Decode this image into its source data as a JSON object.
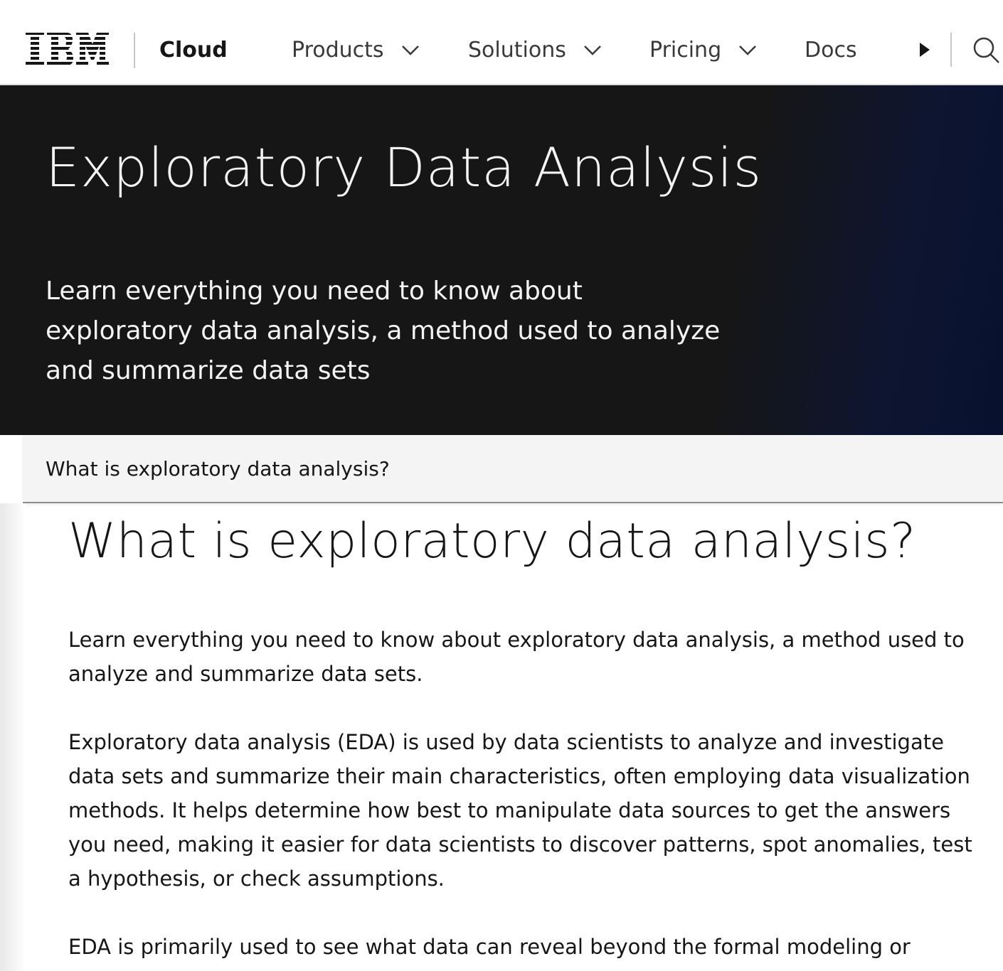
{
  "masthead": {
    "logo_text": "IBM",
    "brand": "Cloud",
    "nav": [
      {
        "label": "Products"
      },
      {
        "label": "Solutions"
      },
      {
        "label": "Pricing"
      },
      {
        "label": "Docs"
      }
    ],
    "icons": {
      "more": "caret-right-icon",
      "search": "search-icon",
      "dropdown": "chevron-down-icon"
    }
  },
  "hero": {
    "title": "Exploratory Data Analysis",
    "subtitle": "Learn everything you need to know about exploratory data analysis, a method used to analyze and summarize data sets",
    "background_color": "#161616",
    "gradient_accent": "#07122f"
  },
  "toc": {
    "items": [
      {
        "label": "What is exploratory data analysis?"
      }
    ]
  },
  "article": {
    "heading": "What is exploratory data analysis?",
    "paragraphs": [
      "Learn everything you need to know about exploratory data analysis, a method used to analyze and summarize data sets.",
      "Exploratory data analysis (EDA) is used by data scientists to analyze and investigate data sets and summarize their main characteristics, often employing data visualization methods. It helps determine how best to manipulate data sources to get the answers you need, making it easier for data scientists to discover patterns, spot anomalies, test a hypothesis, or check assumptions.",
      "EDA is primarily used to see what data can reveal beyond the formal modeling or"
    ]
  }
}
